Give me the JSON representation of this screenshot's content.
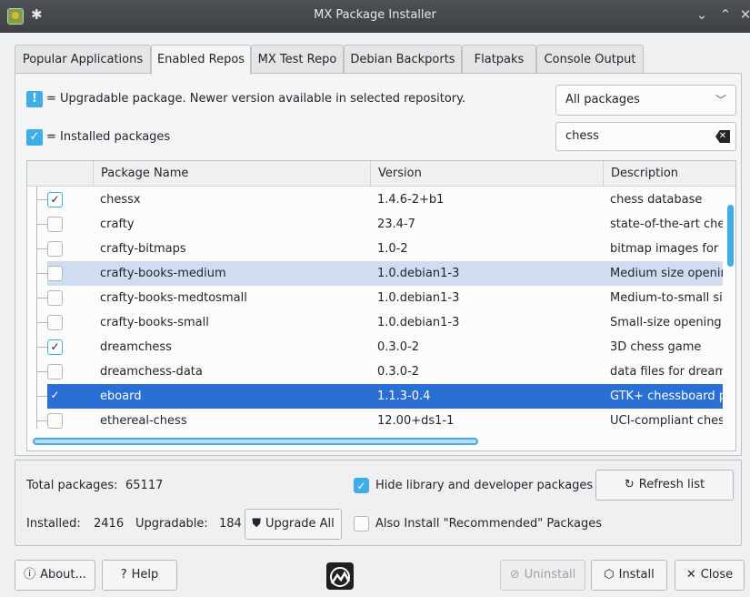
{
  "window": {
    "title": "MX Package Installer",
    "pin_icon": "pin-icon",
    "controls": [
      "minimize-icon",
      "maximize-icon",
      "close-icon"
    ]
  },
  "tabs": [
    {
      "label": "Popular Applications"
    },
    {
      "label": "Enabled Repos",
      "active": true
    },
    {
      "label": "MX Test Repo"
    },
    {
      "label": "Debian Backports"
    },
    {
      "label": "Flatpaks"
    },
    {
      "label": "Console Output"
    }
  ],
  "legend": {
    "upgradable_symbol": "!",
    "upgradable_text": "= Upgradable package. Newer version available in selected repository.",
    "installed_symbol": "✓",
    "installed_text": "= Installed packages"
  },
  "filter": {
    "selected": "All packages"
  },
  "search": {
    "value": "chess"
  },
  "table": {
    "columns": [
      "Package Name",
      "Version",
      "Description"
    ],
    "rows": [
      {
        "name": "chessx",
        "version": "1.4.6-2+b1",
        "description": "chess database",
        "installed": true
      },
      {
        "name": "crafty",
        "version": "23.4-7",
        "description": "state-of-the-art che",
        "installed": false
      },
      {
        "name": "crafty-bitmaps",
        "version": "1.0-2",
        "description": "bitmap images for c",
        "installed": false
      },
      {
        "name": "crafty-books-medium",
        "version": "1.0.debian1-3",
        "description": "Medium size openin",
        "installed": false
      },
      {
        "name": "crafty-books-medtosmall",
        "version": "1.0.debian1-3",
        "description": "Medium-to-small si",
        "installed": false
      },
      {
        "name": "crafty-books-small",
        "version": "1.0.debian1-3",
        "description": "Small-size opening",
        "installed": false
      },
      {
        "name": "dreamchess",
        "version": "0.3.0-2",
        "description": "3D chess game",
        "installed": true
      },
      {
        "name": "dreamchess-data",
        "version": "0.3.0-2",
        "description": "data files for dream",
        "installed": false
      },
      {
        "name": "eboard",
        "version": "1.1.3-0.4",
        "description": "GTK+ chessboard p",
        "installed": true
      },
      {
        "name": "ethereal-chess",
        "version": "12.00+ds1-1",
        "description": "UCI-compliant ches",
        "installed": false
      }
    ]
  },
  "stats": {
    "total_label": "Total packages:",
    "total_value": "65117",
    "installed_label": "Installed:",
    "installed_value": "2416",
    "upgradable_label": "Upgradable:",
    "upgradable_value": "184"
  },
  "options": {
    "hide_libs_label": "Hide library and developer packages",
    "hide_libs_checked": true,
    "recommended_label": "Also Install \"Recommended\" Packages",
    "recommended_checked": false
  },
  "buttons": {
    "refresh": "Refresh list",
    "upgrade_all": "Upgrade All",
    "about": "About...",
    "help": "Help",
    "uninstall": "Uninstall",
    "install": "Install",
    "close": "Close"
  }
}
